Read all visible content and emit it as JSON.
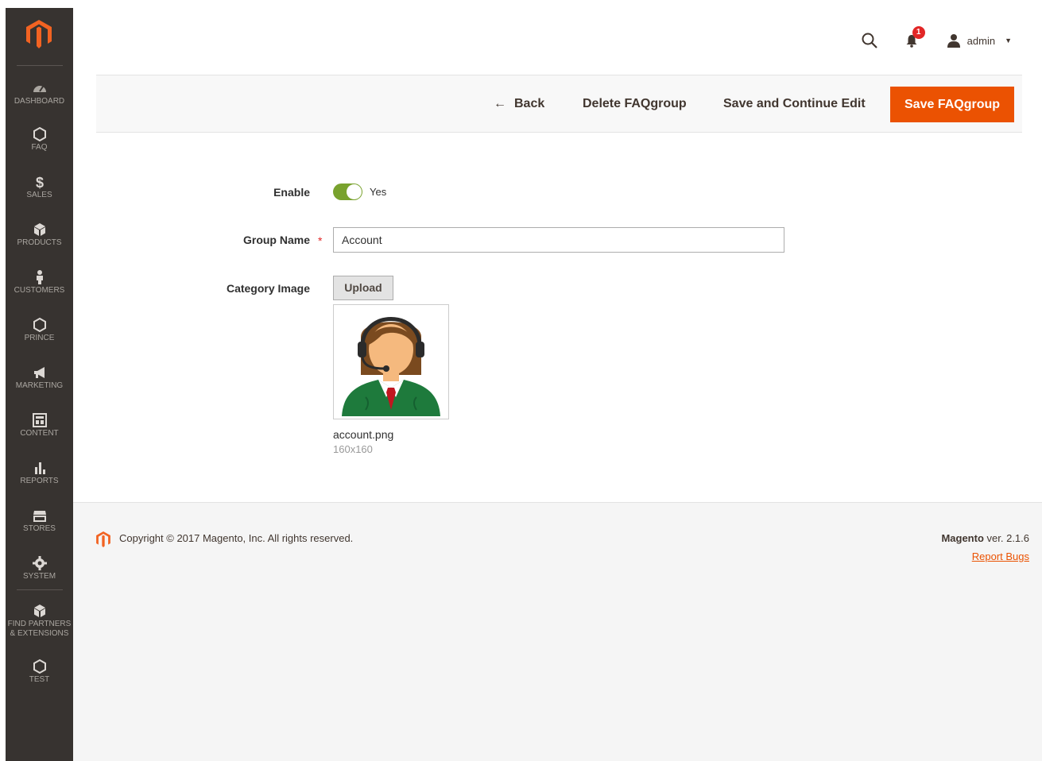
{
  "sidebar": {
    "items": [
      {
        "label": "DASHBOARD",
        "icon": "dashboard-icon"
      },
      {
        "label": "FAQ",
        "icon": "hexagon-icon"
      },
      {
        "label": "SALES",
        "icon": "dollar-icon"
      },
      {
        "label": "PRODUCTS",
        "icon": "cube-icon"
      },
      {
        "label": "CUSTOMERS",
        "icon": "person-icon"
      },
      {
        "label": "PRINCE",
        "icon": "hexagon-icon"
      },
      {
        "label": "MARKETING",
        "icon": "megaphone-icon"
      },
      {
        "label": "CONTENT",
        "icon": "layout-icon"
      },
      {
        "label": "REPORTS",
        "icon": "bar-chart-icon"
      },
      {
        "label": "STORES",
        "icon": "store-icon"
      },
      {
        "label": "SYSTEM",
        "icon": "gear-icon"
      },
      {
        "label": "FIND PARTNERS",
        "label2": "& EXTENSIONS",
        "icon": "box-icon"
      },
      {
        "label": "TEST",
        "icon": "hexagon-icon"
      }
    ]
  },
  "header": {
    "notification_count": "1",
    "user": "admin"
  },
  "actions": {
    "back": "Back",
    "delete": "Delete FAQgroup",
    "save_continue": "Save and Continue Edit",
    "save": "Save FAQgroup"
  },
  "form": {
    "enable_label": "Enable",
    "enable_value": "Yes",
    "group_name_label": "Group Name",
    "required_mark": "*",
    "group_name_value": "Account",
    "category_image_label": "Category Image",
    "upload_label": "Upload",
    "file_name": "account.png",
    "file_size": "160x160"
  },
  "footer": {
    "copyright": "Copyright © 2017 Magento, Inc. All rights reserved.",
    "brand": "Magento",
    "version": " ver. 2.1.6",
    "report_bugs": "Report Bugs"
  },
  "colors": {
    "accent": "#eb5202",
    "sidebar_bg": "#373330",
    "toggle_on": "#79a22e"
  }
}
